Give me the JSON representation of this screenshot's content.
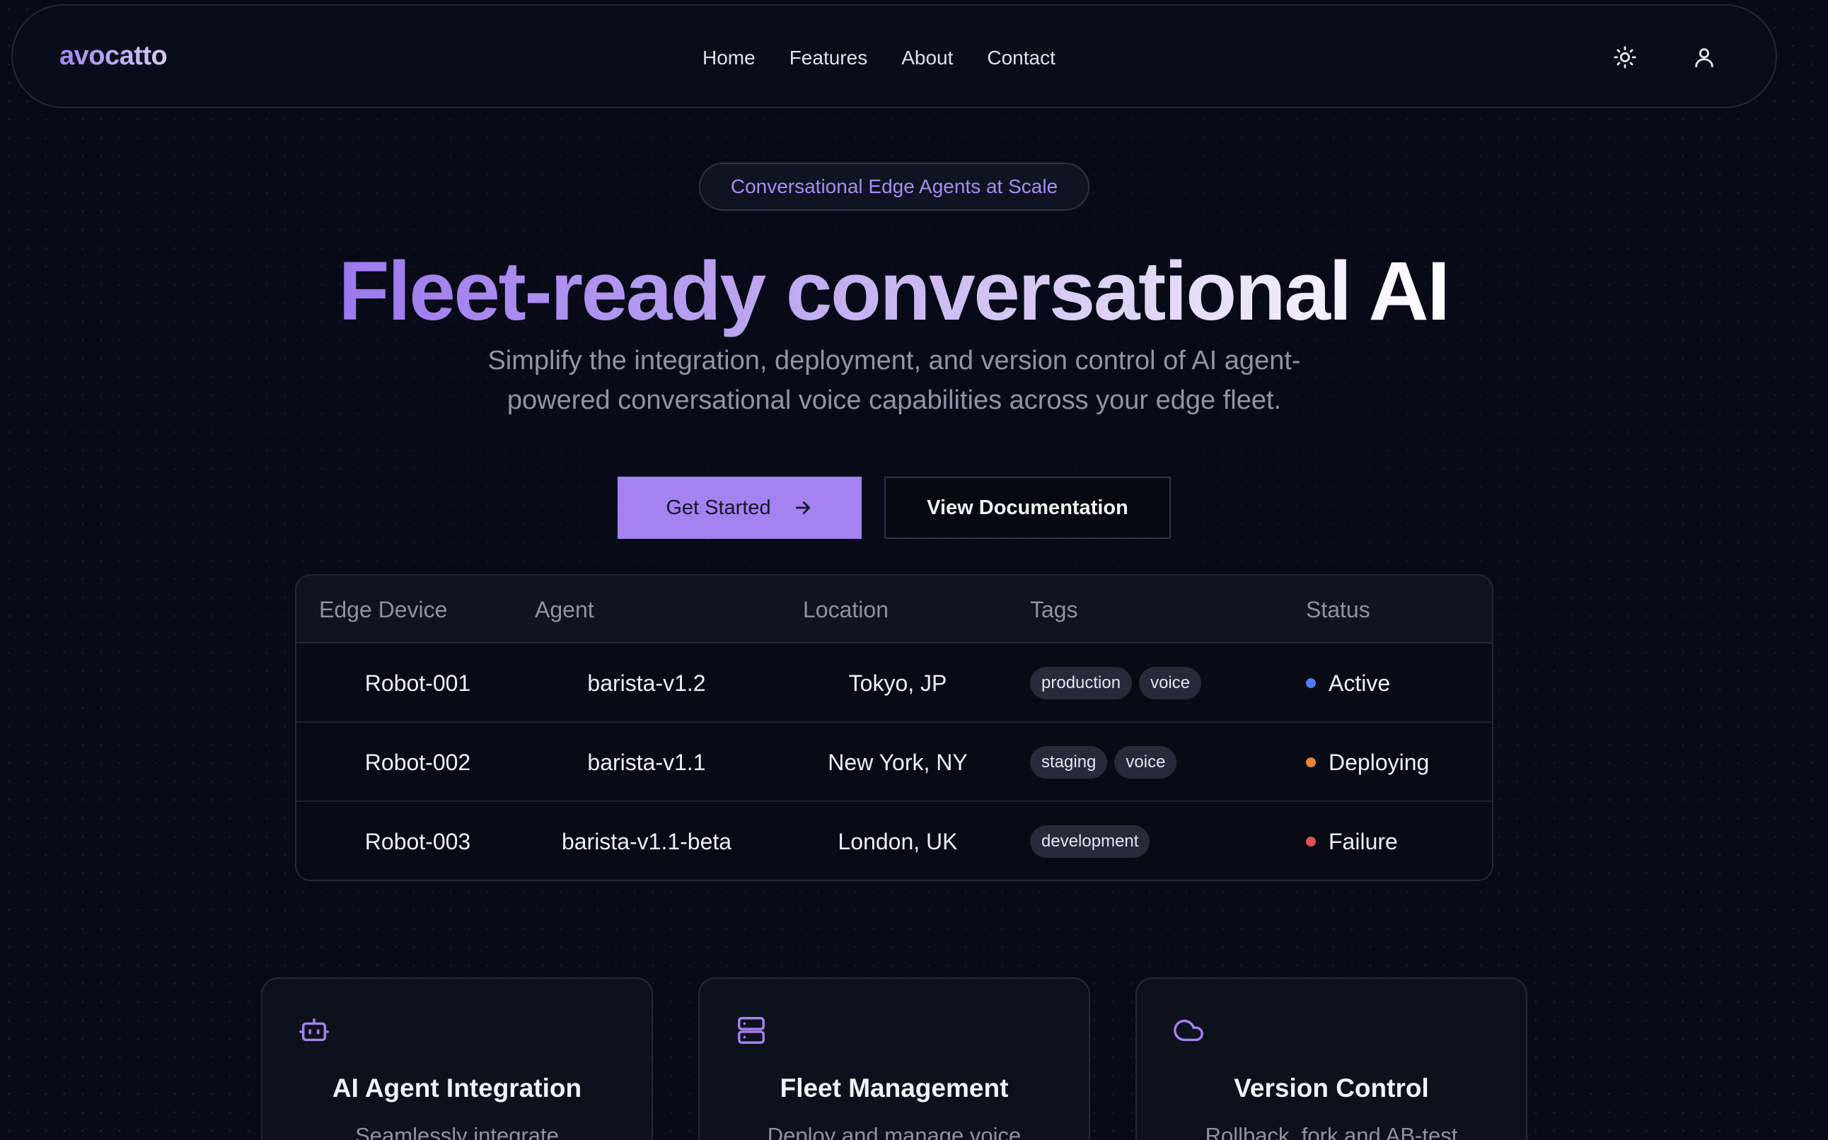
{
  "nav": {
    "logo": "avocatto",
    "links": [
      "Home",
      "Features",
      "About",
      "Contact"
    ],
    "icons": [
      "sun-icon",
      "user-icon"
    ]
  },
  "hero": {
    "badge": "Conversational Edge Agents at Scale",
    "headline": "Fleet-ready conversational AI",
    "subtitle_line1": "Simplify the integration, deployment, and version control of AI agent-",
    "subtitle_line2": "powered conversational voice capabilities across your edge fleet.",
    "primary_button": "Get Started",
    "secondary_button": "View Documentation"
  },
  "table": {
    "headers": [
      "Edge Device",
      "Agent",
      "Location",
      "Tags",
      "Status"
    ],
    "rows": [
      {
        "device": "Robot-001",
        "agent": "barista-v1.2",
        "location": "Tokyo, JP",
        "tags": [
          "production",
          "voice"
        ],
        "status": "Active",
        "status_color": "#4f7bf0"
      },
      {
        "device": "Robot-002",
        "agent": "barista-v1.1",
        "location": "New York, NY",
        "tags": [
          "staging",
          "voice"
        ],
        "status": "Deploying",
        "status_color": "#e5833a"
      },
      {
        "device": "Robot-003",
        "agent": "barista-v1.1-beta",
        "location": "London, UK",
        "tags": [
          "development"
        ],
        "status": "Failure",
        "status_color": "#e05252"
      }
    ]
  },
  "features": [
    {
      "icon": "bot-icon",
      "title": "AI Agent Integration",
      "desc": "Seamlessly integrate"
    },
    {
      "icon": "server-icon",
      "title": "Fleet Management",
      "desc": "Deploy and manage voice"
    },
    {
      "icon": "cloud-icon",
      "title": "Version Control",
      "desc": "Rollback, fork and AB-test"
    }
  ],
  "colors": {
    "accent": "#a482ef",
    "background": "#080b17"
  }
}
